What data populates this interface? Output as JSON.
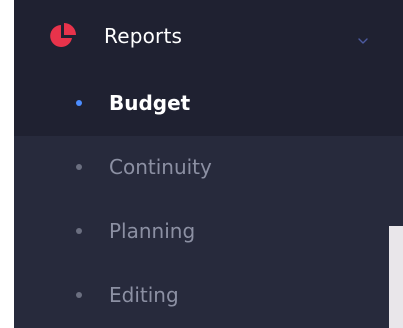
{
  "menu": {
    "header": {
      "label": "Reports",
      "icon": "pie-chart-icon",
      "expanded": true
    },
    "items": [
      {
        "label": "Budget",
        "active": true
      },
      {
        "label": "Continuity",
        "active": false
      },
      {
        "label": "Planning",
        "active": false
      },
      {
        "label": "Editing",
        "active": false
      }
    ]
  },
  "colors": {
    "sidebar_bg": "#272a3c",
    "active_bg": "#1f2131",
    "icon_red": "#e8334b",
    "active_bullet": "#4c8dff",
    "inactive_text": "#8c90a3",
    "active_text": "#ffffff"
  }
}
